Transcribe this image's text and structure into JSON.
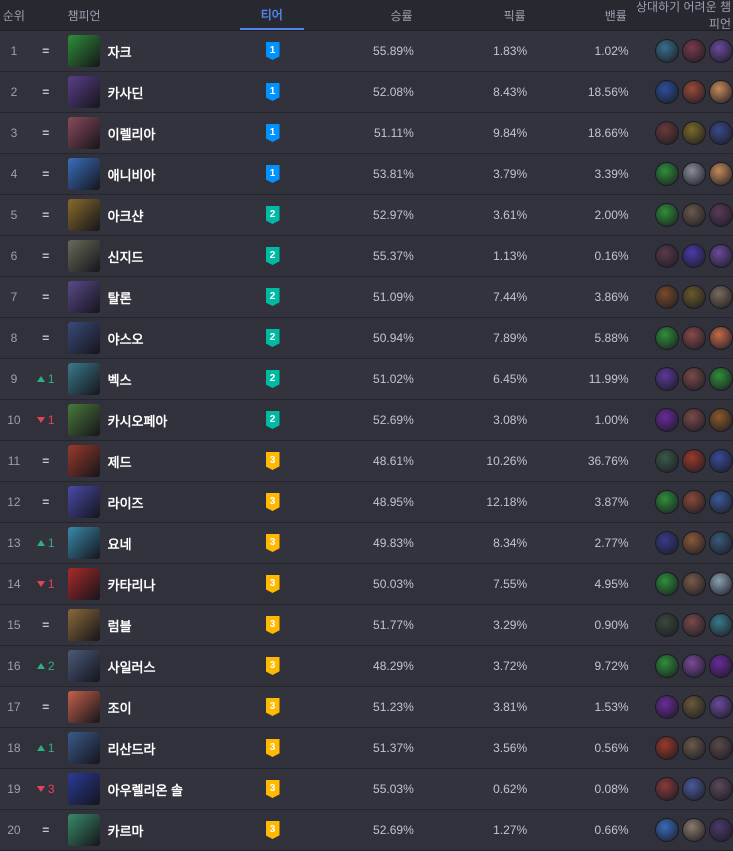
{
  "headers": {
    "rank": "순위",
    "champion": "챔피언",
    "tier": "티어",
    "winrate": "승률",
    "pickrate": "픽률",
    "banrate": "밴률",
    "counters": "상대하기 어려운 챔피언"
  },
  "colors": {
    "accent": "#5383e8",
    "tier1": "#0093ff",
    "tier2": "#00bba3",
    "tier3": "#ffb900",
    "up": "#2daf7f",
    "down": "#e84057"
  },
  "rows": [
    {
      "rank": "1",
      "change": "=",
      "dir": "same",
      "name": "자크",
      "tier": "1",
      "win": "55.89%",
      "pick": "1.83%",
      "ban": "1.02%",
      "color": "#2f8f3a",
      "counters": [
        "#3a6f8e",
        "#7a3a4a",
        "#6a4a9a"
      ]
    },
    {
      "rank": "2",
      "change": "=",
      "dir": "same",
      "name": "카사딘",
      "tier": "1",
      "win": "52.08%",
      "pick": "8.43%",
      "ban": "18.56%",
      "color": "#5a3f8a",
      "counters": [
        "#2c4f9a",
        "#9a4a3a",
        "#c58a5a"
      ]
    },
    {
      "rank": "3",
      "change": "=",
      "dir": "same",
      "name": "이렐리아",
      "tier": "1",
      "win": "51.11%",
      "pick": "9.84%",
      "ban": "18.66%",
      "color": "#8a4a5a",
      "counters": [
        "#6a3a3a",
        "#7a6a2a",
        "#3a4a8a"
      ]
    },
    {
      "rank": "4",
      "change": "=",
      "dir": "same",
      "name": "애니비아",
      "tier": "1",
      "win": "53.81%",
      "pick": "3.79%",
      "ban": "3.39%",
      "color": "#3a6fbf",
      "counters": [
        "#2f8f3a",
        "#8a8a9a",
        "#c58a5a"
      ]
    },
    {
      "rank": "5",
      "change": "=",
      "dir": "same",
      "name": "아크샨",
      "tier": "2",
      "win": "52.97%",
      "pick": "3.61%",
      "ban": "2.00%",
      "color": "#8a6a2a",
      "counters": [
        "#2f8f3a",
        "#6a5a4a",
        "#5a3a5a"
      ]
    },
    {
      "rank": "6",
      "change": "=",
      "dir": "same",
      "name": "신지드",
      "tier": "2",
      "win": "55.37%",
      "pick": "1.13%",
      "ban": "0.16%",
      "color": "#6a6a5a",
      "counters": [
        "#5a3a4a",
        "#4a3aaa",
        "#6a4a9a"
      ]
    },
    {
      "rank": "7",
      "change": "=",
      "dir": "same",
      "name": "탈론",
      "tier": "2",
      "win": "51.09%",
      "pick": "7.44%",
      "ban": "3.86%",
      "color": "#5a4a8a",
      "counters": [
        "#7a4a2a",
        "#6a5a2a",
        "#7a6a5a"
      ]
    },
    {
      "rank": "8",
      "change": "=",
      "dir": "same",
      "name": "야스오",
      "tier": "2",
      "win": "50.94%",
      "pick": "7.89%",
      "ban": "5.88%",
      "color": "#3a4a7a",
      "counters": [
        "#2f8f3a",
        "#8a4a4a",
        "#c56a4a"
      ]
    },
    {
      "rank": "9",
      "change": "1",
      "dir": "up",
      "name": "벡스",
      "tier": "2",
      "win": "51.02%",
      "pick": "6.45%",
      "ban": "11.99%",
      "color": "#3a7a8a",
      "counters": [
        "#5a3a9a",
        "#7a4a4a",
        "#2f8f3a"
      ]
    },
    {
      "rank": "10",
      "change": "1",
      "dir": "down",
      "name": "카시오페아",
      "tier": "2",
      "win": "52.69%",
      "pick": "3.08%",
      "ban": "1.00%",
      "color": "#4a7a3a",
      "counters": [
        "#6a2a9a",
        "#7a4a4a",
        "#8a5a2a"
      ]
    },
    {
      "rank": "11",
      "change": "=",
      "dir": "same",
      "name": "제드",
      "tier": "3",
      "win": "48.61%",
      "pick": "10.26%",
      "ban": "36.76%",
      "color": "#9a3a2a",
      "counters": [
        "#3a5a4a",
        "#9a3a2a",
        "#3a4a9a"
      ]
    },
    {
      "rank": "12",
      "change": "=",
      "dir": "same",
      "name": "라이즈",
      "tier": "3",
      "win": "48.95%",
      "pick": "12.18%",
      "ban": "3.87%",
      "color": "#4a4aaa",
      "counters": [
        "#2f8f3a",
        "#8a4a3a",
        "#3a5a9a"
      ]
    },
    {
      "rank": "13",
      "change": "1",
      "dir": "up",
      "name": "요네",
      "tier": "3",
      "win": "49.83%",
      "pick": "8.34%",
      "ban": "2.77%",
      "color": "#3a8aaa",
      "counters": [
        "#3a3a8a",
        "#8a5a3a",
        "#3a5a7a"
      ]
    },
    {
      "rank": "14",
      "change": "1",
      "dir": "down",
      "name": "카타리나",
      "tier": "3",
      "win": "50.03%",
      "pick": "7.55%",
      "ban": "4.95%",
      "color": "#aa2a2a",
      "counters": [
        "#2f8f3a",
        "#7a5a4a",
        "#8aa0b0"
      ]
    },
    {
      "rank": "15",
      "change": "=",
      "dir": "same",
      "name": "럼블",
      "tier": "3",
      "win": "51.77%",
      "pick": "3.29%",
      "ban": "0.90%",
      "color": "#8a6a3a",
      "counters": [
        "#3a4a3a",
        "#7a4a4a",
        "#3a7a8a"
      ]
    },
    {
      "rank": "16",
      "change": "2",
      "dir": "up",
      "name": "사일러스",
      "tier": "3",
      "win": "48.29%",
      "pick": "3.72%",
      "ban": "9.72%",
      "color": "#4a5a7a",
      "counters": [
        "#2f8f3a",
        "#7a4a9a",
        "#6a2a9a"
      ]
    },
    {
      "rank": "17",
      "change": "=",
      "dir": "same",
      "name": "조이",
      "tier": "3",
      "win": "51.23%",
      "pick": "3.81%",
      "ban": "1.53%",
      "color": "#c5604a",
      "counters": [
        "#6a2a9a",
        "#6a5a3a",
        "#6a4a9a"
      ]
    },
    {
      "rank": "18",
      "change": "1",
      "dir": "up",
      "name": "리산드라",
      "tier": "3",
      "win": "51.37%",
      "pick": "3.56%",
      "ban": "0.56%",
      "color": "#3a5a8a",
      "counters": [
        "#9a3a2a",
        "#6a5a4a",
        "#5a4a4a"
      ]
    },
    {
      "rank": "19",
      "change": "3",
      "dir": "down",
      "name": "아우렐리온 솔",
      "tier": "3",
      "win": "55.03%",
      "pick": "0.62%",
      "ban": "0.08%",
      "color": "#2a3a9a",
      "counters": [
        "#8a3a3a",
        "#4a5a9a",
        "#5a4a5a"
      ]
    },
    {
      "rank": "20",
      "change": "=",
      "dir": "same",
      "name": "카르마",
      "tier": "3",
      "win": "52.69%",
      "pick": "1.27%",
      "ban": "0.66%",
      "color": "#3a8a6a",
      "counters": [
        "#3a6aba",
        "#8a7a6a",
        "#4a3a6a"
      ]
    }
  ]
}
